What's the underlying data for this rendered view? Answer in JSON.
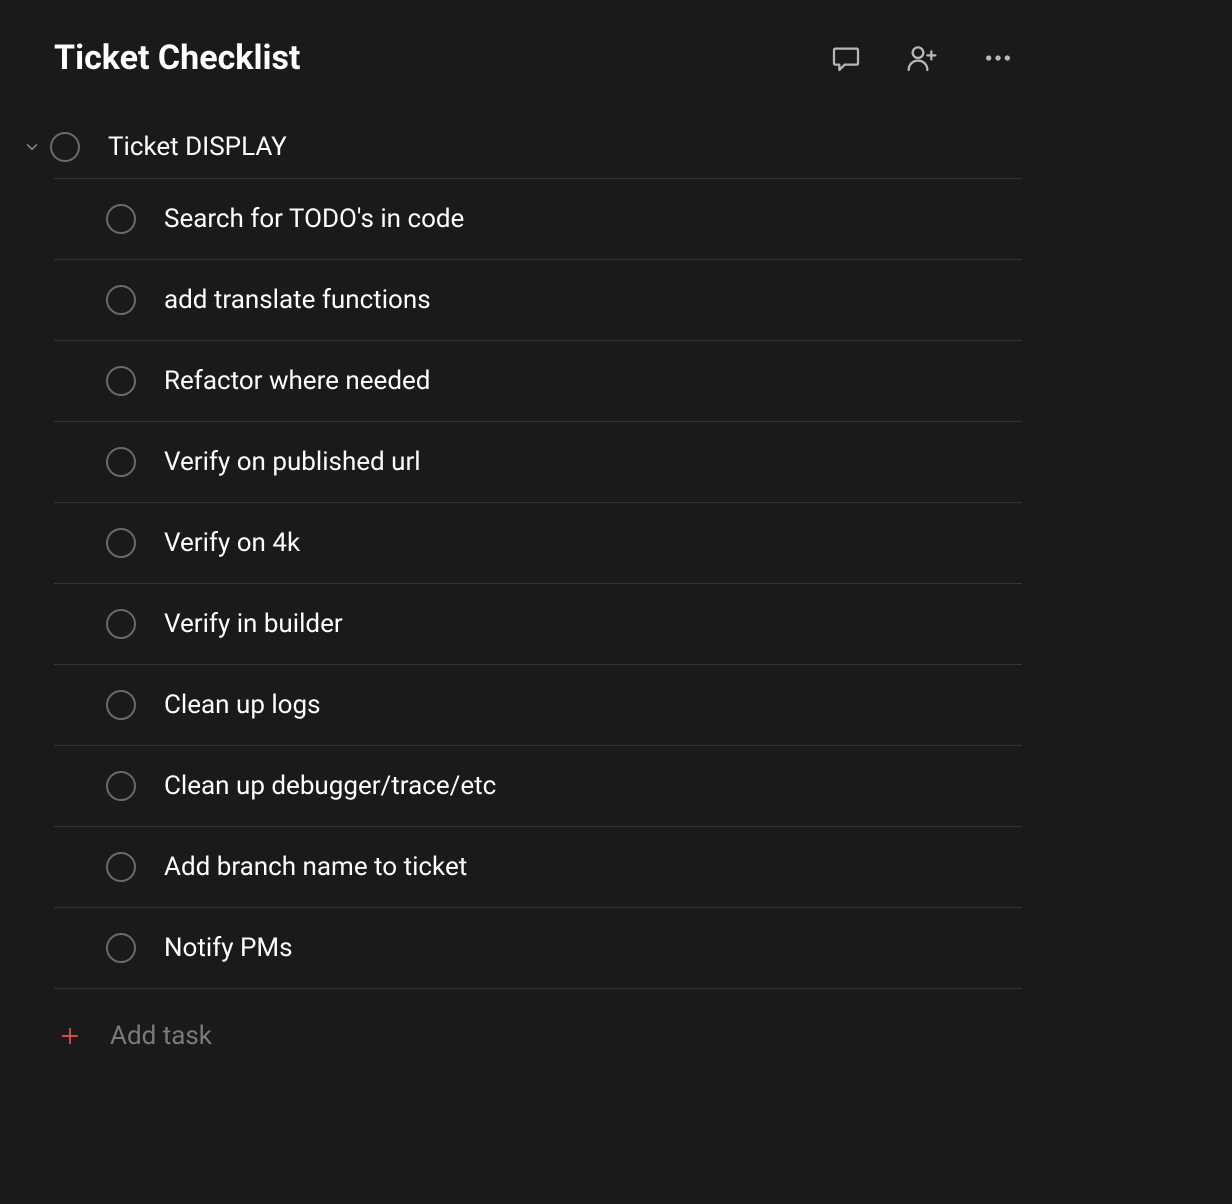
{
  "header": {
    "title": "Ticket Checklist"
  },
  "section": {
    "title": "Ticket DISPLAY",
    "tasks": [
      "Search for TODO's in code",
      "add translate functions",
      "Refactor where needed",
      "Verify on published url",
      "Verify on 4k",
      "Verify in builder",
      "Clean up logs",
      "Clean up debugger/trace/etc",
      "Add branch name to ticket",
      "Notify PMs"
    ]
  },
  "addTask": {
    "label": "Add task"
  },
  "colors": {
    "background": "#1a1a1a",
    "text": "#ffffff",
    "muted": "#7a7a7a",
    "border": "#333333",
    "accent": "#f0524f",
    "iconGray": "#b8b8b8",
    "checkboxBorder": "#6a6a6a"
  }
}
